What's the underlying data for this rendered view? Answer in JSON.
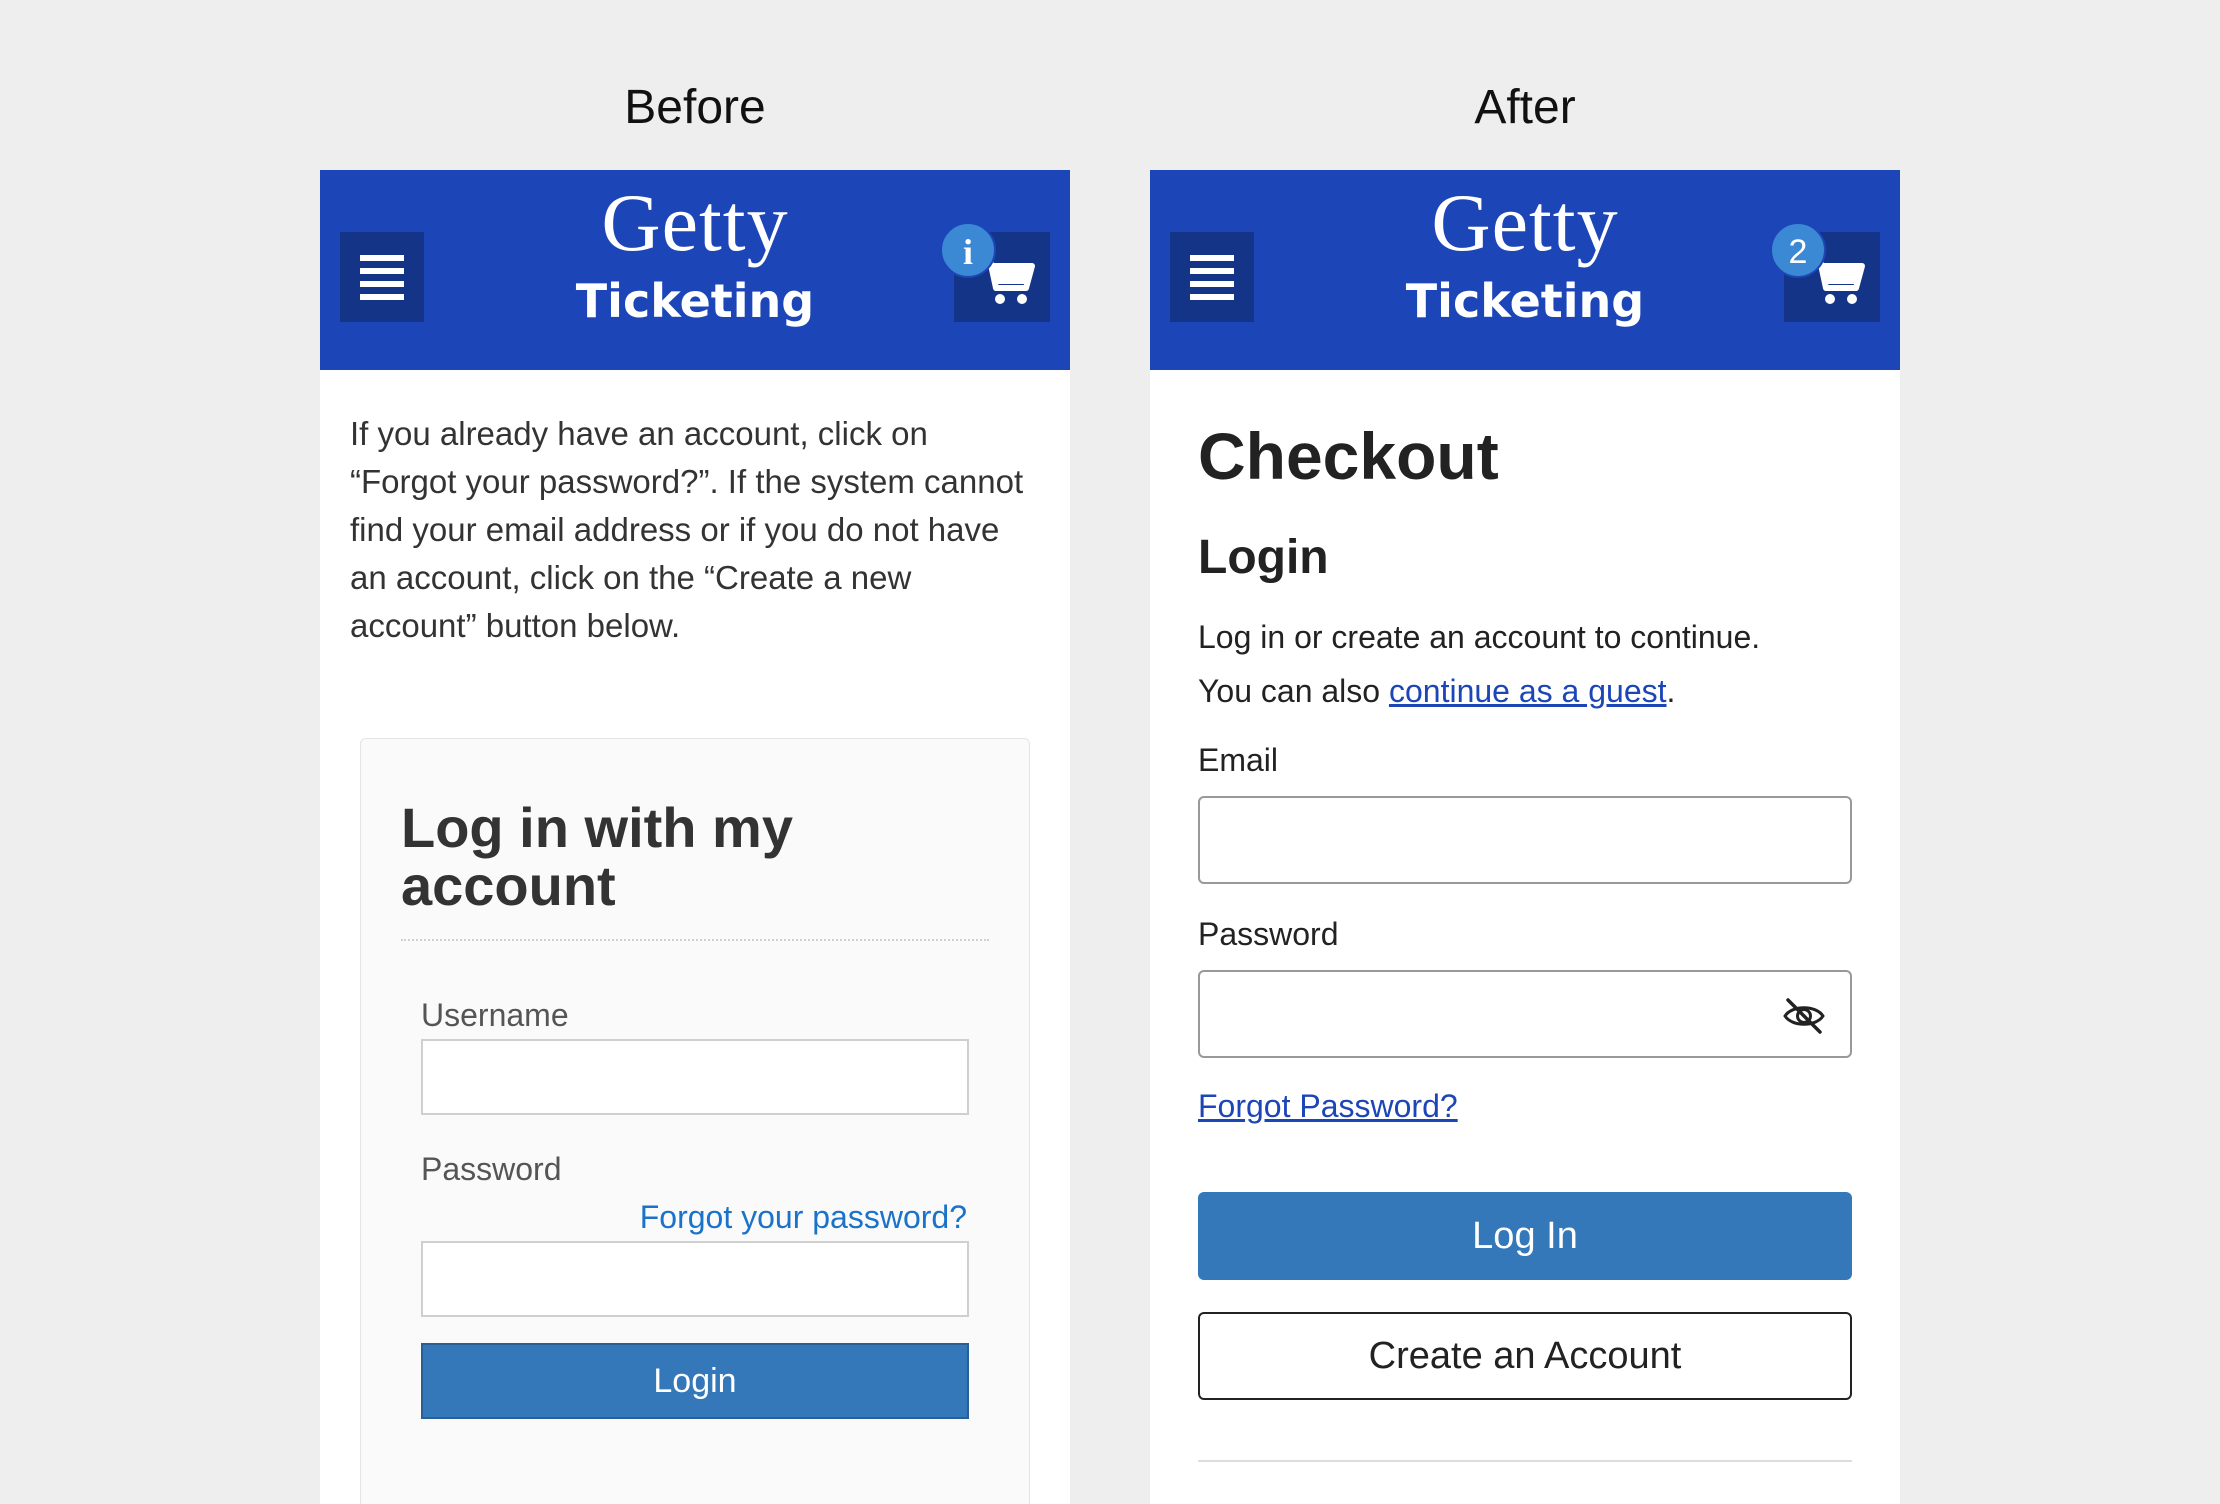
{
  "labels": {
    "before": "Before",
    "after": "After"
  },
  "header": {
    "brand_top": "Getty",
    "brand_bottom": "Ticketing",
    "menu_icon": "hamburger-menu-icon",
    "cart_icon": "shopping-cart-icon"
  },
  "before": {
    "badge": "i",
    "intro": "If you already have an account, click on “Forgot your password?”.   If the system cannot find your email address or if you do not have an account, click on the “Create a new account” button below.",
    "card_title": "Log in with my account",
    "username_label": "Username",
    "username_value": "",
    "password_label": "Password",
    "forgot_link": "Forgot your password?",
    "password_value": "",
    "login_button": "Login"
  },
  "after": {
    "badge": "2",
    "page_title": "Checkout",
    "section_title": "Login",
    "intro_line1": "Log in or create an account to continue.",
    "intro_line2_prefix": "You can also ",
    "guest_link": "continue as a guest",
    "intro_line2_suffix": ".",
    "email_label": "Email",
    "email_value": "",
    "password_label": "Password",
    "password_value": "",
    "password_toggle_icon": "eye-slash-icon",
    "forgot_link": "Forgot Password?",
    "login_button": "Log In",
    "create_button": "Create an Account"
  },
  "colors": {
    "header": "#1c45b8",
    "header_button": "#143587",
    "badge": "#3b88d4",
    "primary_button": "#3478ba",
    "link": "#1a73c9",
    "page_background": "#eeeeee"
  }
}
